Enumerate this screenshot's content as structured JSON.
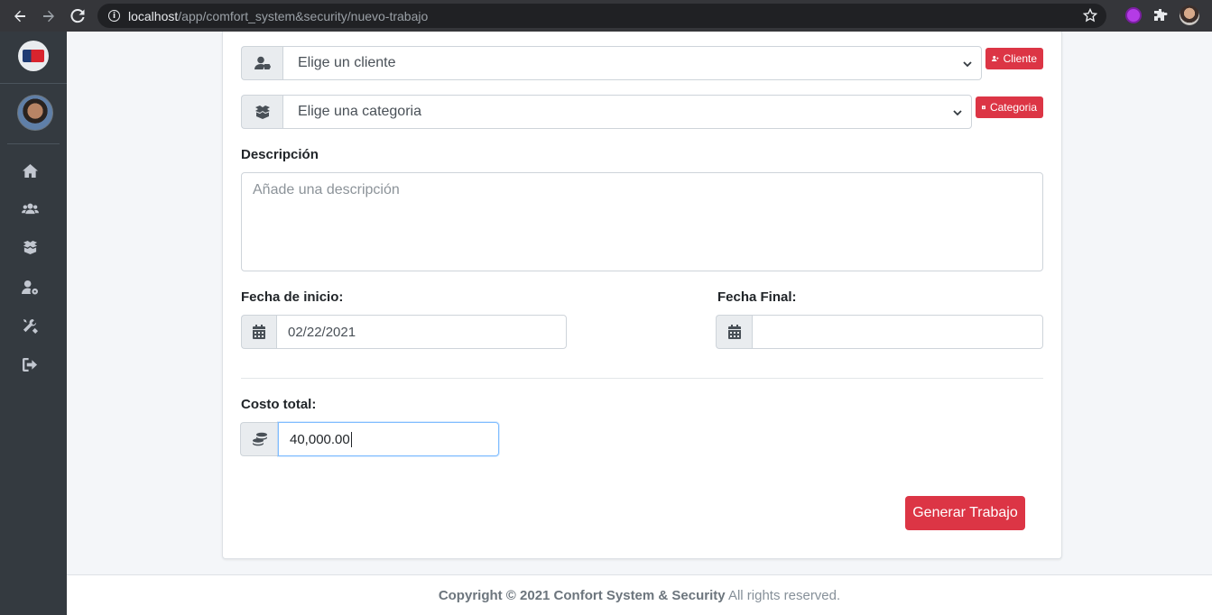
{
  "browser": {
    "url_host": "localhost",
    "url_path": "/app/comfort_system&security/nuevo-trabajo"
  },
  "form": {
    "cliente_select": "Elige un cliente",
    "cliente_button": "Cliente",
    "categoria_select": "Elige una categoria",
    "categoria_button": "Categoria",
    "descripcion_label": "Descripción",
    "descripcion_placeholder": "Añade una descripción",
    "fecha_inicio_label": "Fecha de inicio:",
    "fecha_inicio_value": "02/22/2021",
    "fecha_final_label": "Fecha Final:",
    "fecha_final_value": "",
    "costo_label": "Costo total:",
    "costo_value": "40,000.00",
    "submit_label": "Generar Trabajo"
  },
  "footer": {
    "prefix": "Copyright © 2021 Confort System & Security",
    "suffix": " All rights reserved."
  },
  "colors": {
    "accent": "#dc3545",
    "sidebar": "#343a40"
  },
  "icons": {
    "sidebar": [
      "home-icon",
      "users-icon",
      "boxes-icon",
      "user-cog-icon",
      "tools-icon",
      "sign-out-icon"
    ]
  }
}
